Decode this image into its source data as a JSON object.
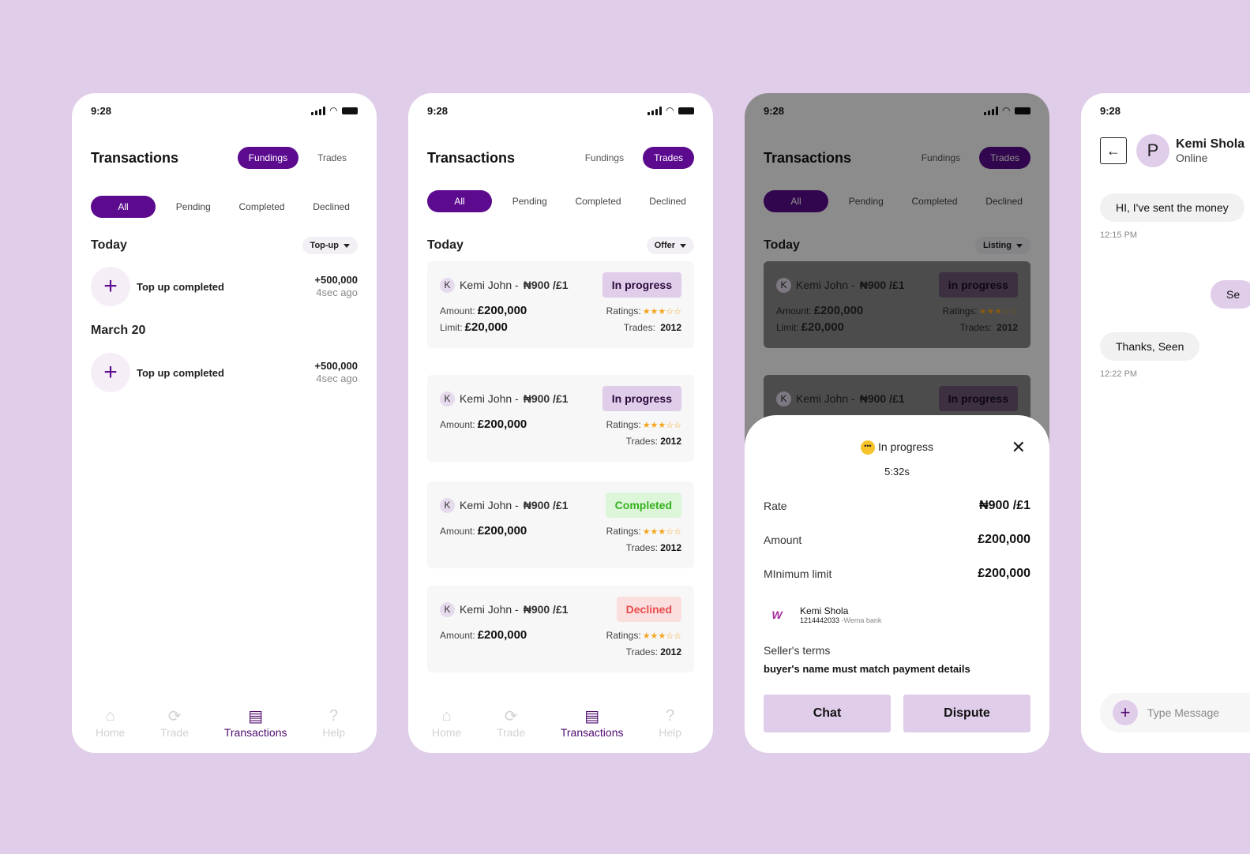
{
  "status": {
    "time": "9:28"
  },
  "transactions_title": "Transactions",
  "top_tabs": {
    "fundings": "Fundings",
    "trades": "Trades"
  },
  "filters": [
    "All",
    "Pending",
    "Completed",
    "Declined"
  ],
  "nav": [
    "Home",
    "Trade",
    "Transactions",
    "Help"
  ],
  "screen1": {
    "section_today": "Today",
    "dropdown": "Top-up",
    "section_march": "March 20",
    "items": [
      {
        "label": "Top up completed",
        "amount": "+500,000",
        "time": "4sec ago"
      },
      {
        "label": "Top up completed",
        "amount": "+500,000",
        "time": "4sec ago"
      }
    ]
  },
  "screen2": {
    "section_today": "Today",
    "dropdown": "Offer",
    "cards": [
      {
        "initial": "K",
        "name": "Kemi John - ",
        "rate": "₦900 /£1",
        "status": "In progress",
        "amount_label": "Amount:",
        "amount": "£200,000",
        "limit_label": "Limit:",
        "limit": "£20,000",
        "ratings_label": "Ratings:",
        "stars": "★★★☆☆",
        "trades_label": "Trades:",
        "trades": "2012"
      },
      {
        "initial": "K",
        "name": "Kemi John - ",
        "rate": "₦900 /£1",
        "status": "In progress",
        "amount_label": "Amount:",
        "amount": "£200,000",
        "ratings_label": "Ratings:",
        "stars": "★★★☆☆",
        "trades_label": "Trades:",
        "trades": "2012"
      },
      {
        "initial": "K",
        "name": "Kemi John - ",
        "rate": "₦900 /£1",
        "status": "Completed",
        "amount_label": "Amount:",
        "amount": "£200,000",
        "ratings_label": "Ratings:",
        "stars": "★★★☆☆",
        "trades_label": "Trades:",
        "trades": "2012"
      },
      {
        "initial": "K",
        "name": "Kemi John - ",
        "rate": "₦900 /£1",
        "status": "Declined",
        "amount_label": "Amount:",
        "amount": "£200,000",
        "ratings_label": "Ratings:",
        "stars": "★★★☆☆",
        "trades_label": "Trades:",
        "trades": "2012"
      }
    ]
  },
  "screen3": {
    "section_today": "Today",
    "dropdown": "Listing",
    "cards": [
      {
        "initial": "K",
        "name": "Kemi John - ",
        "rate": "₦900 /£1",
        "status": "in progress",
        "amount_label": "Amount:",
        "amount": "£200,000",
        "limit_label": "Limit:",
        "limit": "£20,000",
        "ratings_label": "Ratings:",
        "stars": "★★★☆☆",
        "trades_label": "Trades:",
        "trades": "2012"
      },
      {
        "initial": "K",
        "name": "Kemi John - ",
        "rate": "₦900 /£1",
        "status": "In progress"
      }
    ],
    "sheet": {
      "status_icon": "•••",
      "status": "In progress",
      "timer": "5:32s",
      "close": "✕",
      "rate_label": "Rate",
      "rate": "₦900 /£1",
      "amount_label": "Amount",
      "amount": "£200,000",
      "min_label": "MInimum limit",
      "min": "£200,000",
      "bank_logo": "W",
      "bank_name": "Kemi Shola",
      "account": "1214442033",
      "bank": " -Wema bank",
      "terms_label": "Seller's terms",
      "terms": "buyer's name must match payment details",
      "chat_btn": "Chat",
      "dispute_btn": "Dispute"
    }
  },
  "screen4": {
    "back": "←",
    "avatar": "P",
    "name": "Kemi Shola",
    "presence": "Online",
    "messages": [
      {
        "text": "HI, I've sent the money",
        "time": "12:15 PM"
      },
      {
        "text": "Se"
      },
      {
        "text": "Thanks, Seen",
        "time": "12:22 PM"
      }
    ],
    "input_placeholder": "Type Message"
  },
  "colors": {
    "accent": "#5c0b8f",
    "light_accent": "#e0cdea",
    "background": "#e0cdea",
    "star": "#f4a51c"
  }
}
